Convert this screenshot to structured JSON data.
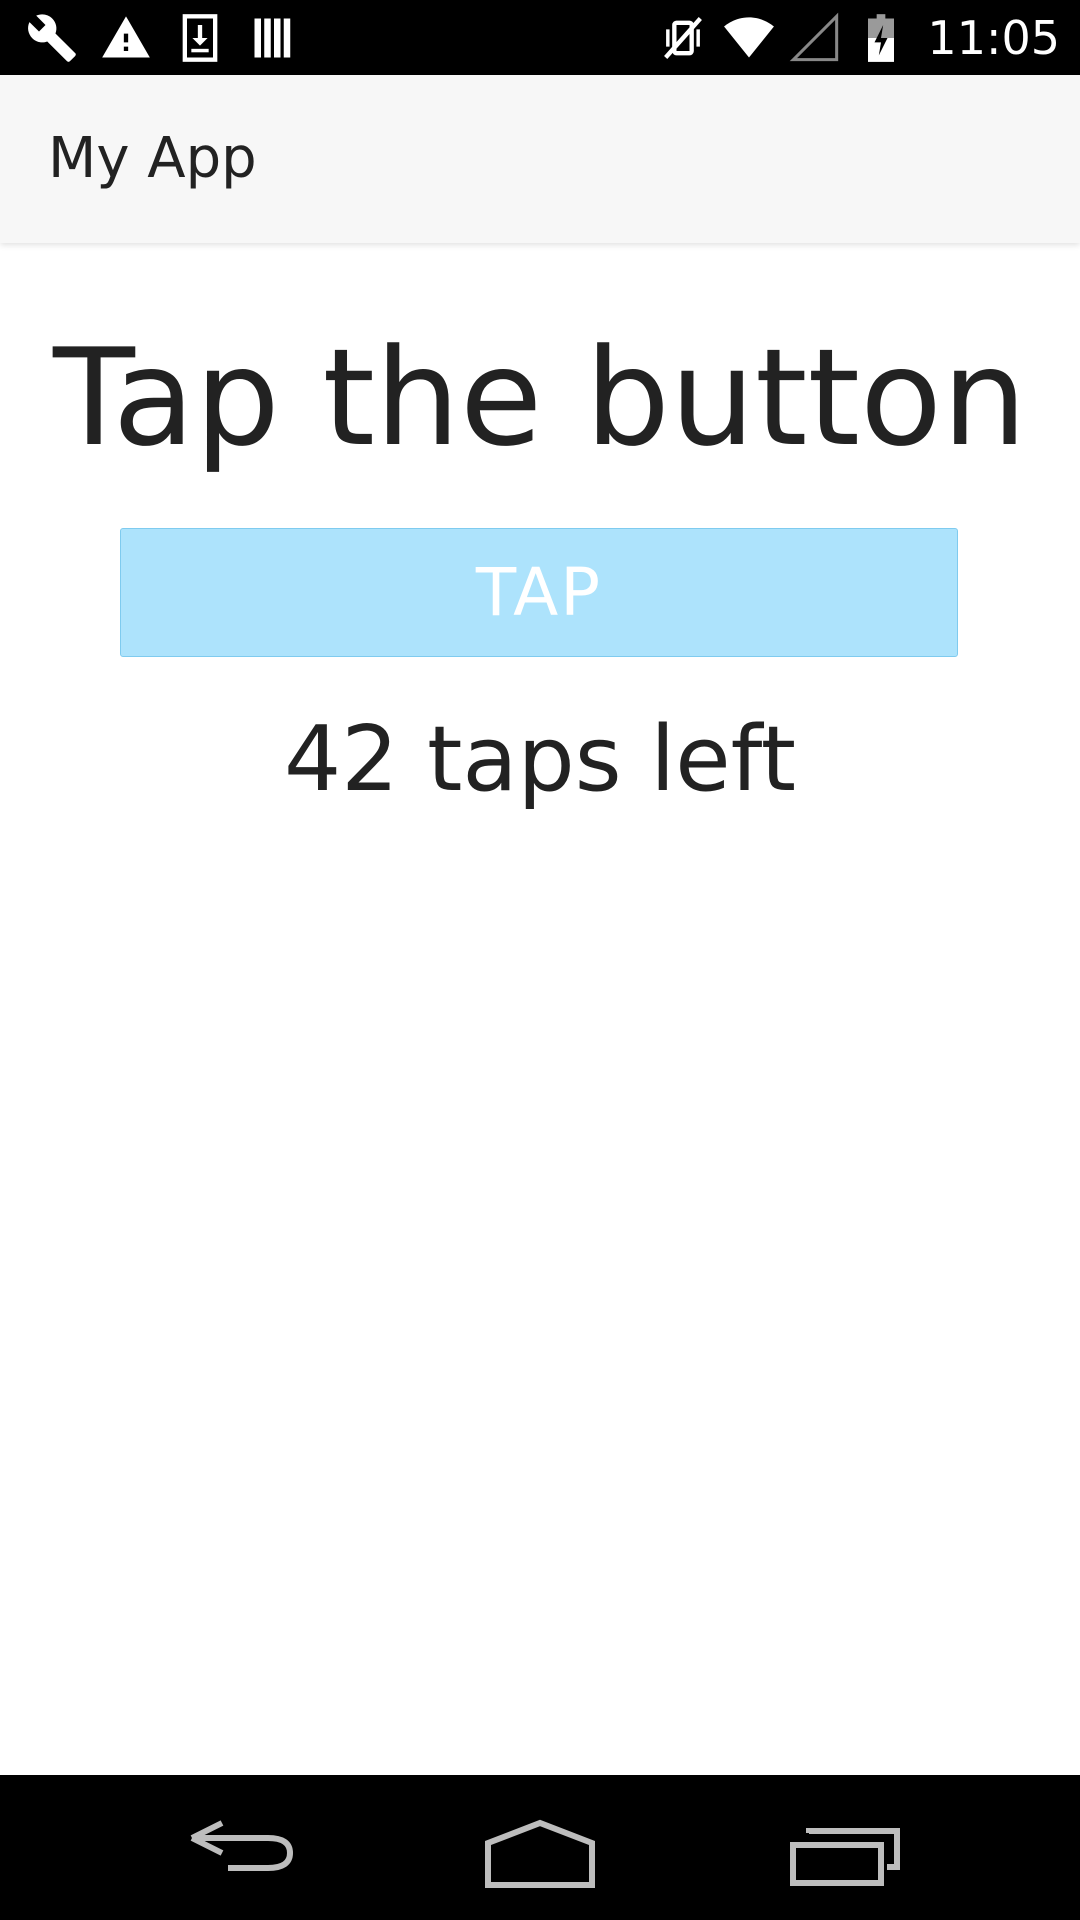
{
  "status_bar": {
    "left_icons": [
      "wrench-icon",
      "warning-icon",
      "download-icon",
      "storage-icon"
    ],
    "right_icons": [
      "vibrate-off-icon",
      "wifi-icon",
      "cell-signal-icon",
      "battery-charging-icon"
    ],
    "time": "11:05"
  },
  "app_bar": {
    "title": "My App",
    "background": "#f7f7f7"
  },
  "main": {
    "headline": "Tap the button",
    "button_label": "TAP",
    "button_color": "#ade3fc",
    "counter_text": "42 taps left"
  },
  "nav_bar": {
    "buttons": [
      "back-icon",
      "home-icon",
      "recents-icon"
    ]
  }
}
